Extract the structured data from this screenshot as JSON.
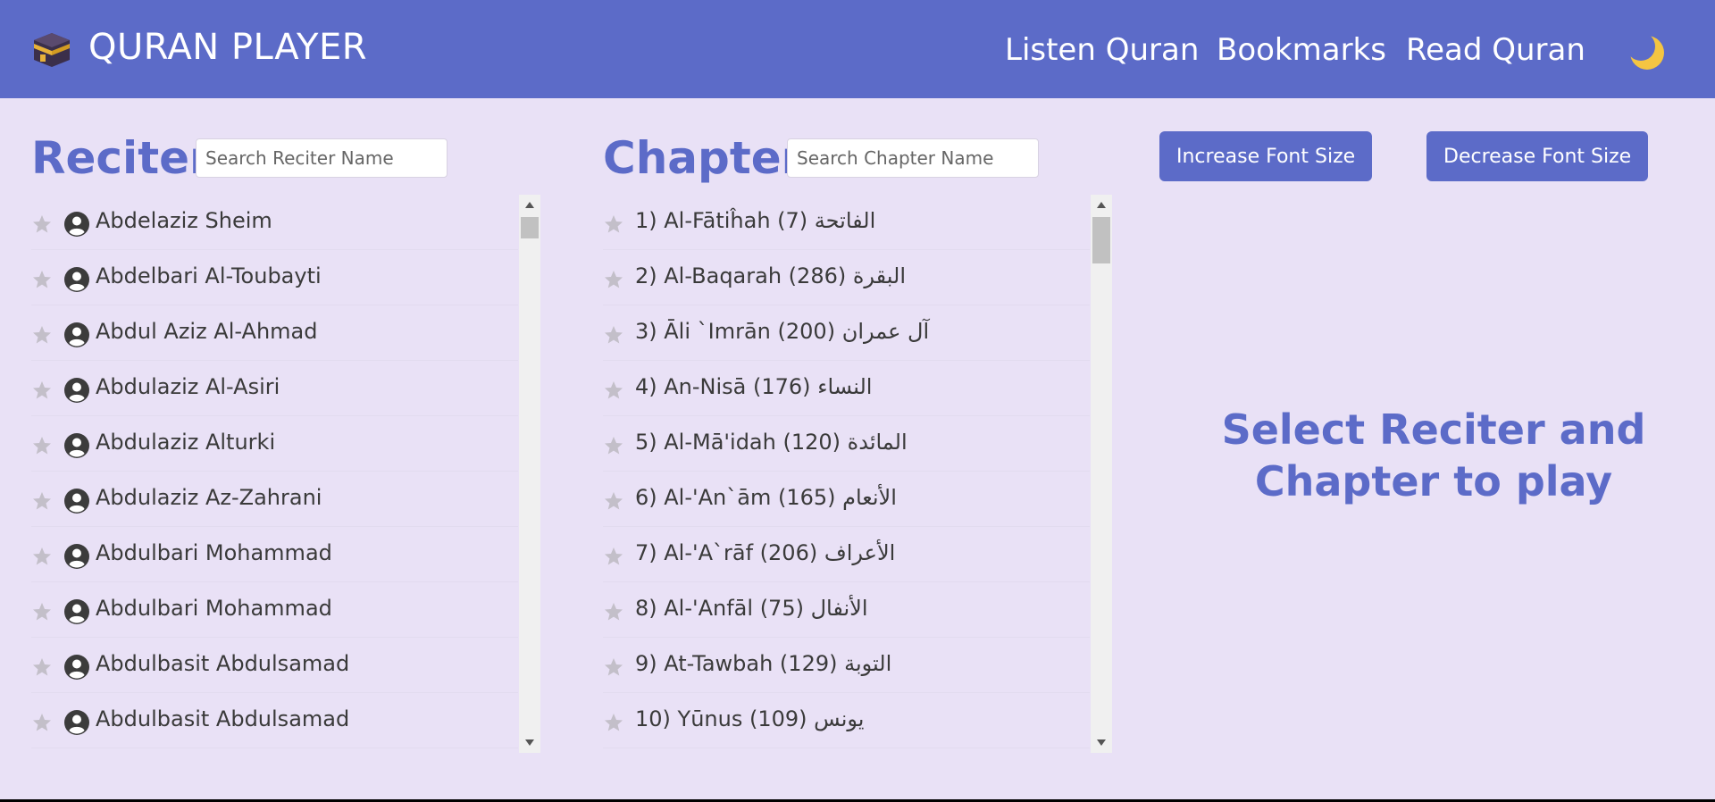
{
  "header": {
    "title": "QURAN PLAYER",
    "logo_icon": "kaaba-icon",
    "nav": [
      {
        "label": "Listen Quran"
      },
      {
        "label": "Bookmarks"
      },
      {
        "label": "Read Quran"
      }
    ],
    "theme_toggle_icon": "moon-icon"
  },
  "reciters": {
    "title": "Reciters",
    "search_placeholder": "Search Reciter Name",
    "items": [
      {
        "name": "Abdelaziz Sheim"
      },
      {
        "name": "Abdelbari Al-Toubayti"
      },
      {
        "name": "Abdul Aziz Al-Ahmad"
      },
      {
        "name": "Abdulaziz Al-Asiri"
      },
      {
        "name": "Abdulaziz Alturki"
      },
      {
        "name": "Abdulaziz Az-Zahrani"
      },
      {
        "name": "Abdulbari Mohammad"
      },
      {
        "name": "Abdulbari Mohammad"
      },
      {
        "name": "Abdulbasit Abdulsamad"
      },
      {
        "name": "Abdulbasit Abdulsamad"
      }
    ]
  },
  "chapters": {
    "title": "Chapters",
    "search_placeholder": "Search Chapter Name",
    "items": [
      {
        "label": "1) Al-Fātiĥah (7) الفاتحة"
      },
      {
        "label": "2) Al-Baqarah (286) البقرة"
      },
      {
        "label": "3) Āli `Imrān (200) آل عمران"
      },
      {
        "label": "4) An-Nisā (176) النساء"
      },
      {
        "label": "5) Al-Mā'idah (120) المائدة"
      },
      {
        "label": "6) Al-'An`ām (165) الأنعام"
      },
      {
        "label": "7) Al-'A`rāf (206) الأعراف"
      },
      {
        "label": "8) Al-'Anfāl (75) الأنفال"
      },
      {
        "label": "9) At-Tawbah (129) التوبة"
      },
      {
        "label": "10) Yūnus (109) يونس"
      }
    ]
  },
  "controls": {
    "increase_label": "Increase Font Size",
    "decrease_label": "Decrease Font Size"
  },
  "player": {
    "message": "Select Reciter and Chapter to play"
  },
  "colors": {
    "accent": "#5c6bc8",
    "background": "#e9e1f6"
  }
}
